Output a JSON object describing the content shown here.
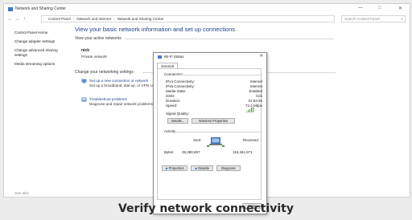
{
  "window": {
    "title": "Network and Sharing Center",
    "controls": {
      "minimize": "—",
      "maximize": "□",
      "close": "✕"
    }
  },
  "addressbar": {
    "back": "←",
    "forward": "→",
    "up": "↑",
    "crumbs": [
      "Control Panel",
      "Network and Internet",
      "Network and Sharing Center"
    ],
    "separator": "›",
    "search_placeholder": "Search Control Panel"
  },
  "sidebar": {
    "items": [
      {
        "label": "Control Panel Home"
      },
      {
        "label": "Change adapter settings"
      },
      {
        "label": "Change advanced sharing settings"
      },
      {
        "label": "Media streaming options"
      }
    ],
    "see_also": "See also"
  },
  "main": {
    "heading": "View your basic network information and set up connections",
    "active_networks_label": "View your active networks",
    "network_name": "nick",
    "network_type": "Private network",
    "change_settings_label": "Change your networking settings",
    "tasks": [
      {
        "link": "Set up a new connection or network",
        "desc": "Set up a broadband, dial-up, or VPN connection; or set up a router or access point."
      },
      {
        "link": "Troubleshoot problems",
        "desc": "Diagnose and repair network problems, or get troubleshooting information."
      }
    ]
  },
  "dialog": {
    "title": "Wi-Fi Status",
    "close": "✕",
    "tab": "General",
    "connection_label": "Connection",
    "rows": [
      {
        "k": "IPv4 Connectivity:",
        "v": "Internet"
      },
      {
        "k": "IPv6 Connectivity:",
        "v": "Internet"
      },
      {
        "k": "Media State:",
        "v": "Enabled"
      },
      {
        "k": "SSID:",
        "v": "nick"
      },
      {
        "k": "Duration:",
        "v": "01:53:36"
      },
      {
        "k": "Speed:",
        "v": "72.2 Mbps"
      }
    ],
    "signal_quality_label": "Signal Quality:",
    "signal_bars": 5,
    "details_button": "Details...",
    "wireless_button": "Wireless Properties",
    "activity_label": "Activity",
    "sent_label": "Sent",
    "received_label": "Received",
    "bytes_label": "Bytes:",
    "bytes_sent": "28,280,657",
    "bytes_received": "116,461,971",
    "properties_button": "Properties",
    "disable_button": "Disable",
    "diagnose_button": "Diagnose",
    "close_button": "Close"
  },
  "caption": "Verify network connectivity",
  "colors": {
    "link": "#1e3f8a",
    "accent": "#3a7bd5",
    "signal": "#4a9a3a"
  }
}
